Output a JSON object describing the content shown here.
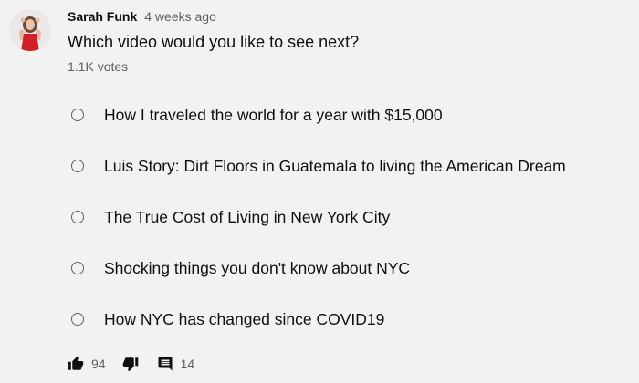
{
  "post": {
    "author": "Sarah Funk",
    "time": "4 weeks ago",
    "question": "Which video would you like to see next?",
    "votes": "1.1K votes",
    "options": [
      {
        "label": "How I traveled the world for a year with $15,000"
      },
      {
        "label": "Luis Story: Dirt Floors in Guatemala to living the American Dream"
      },
      {
        "label": "The True Cost of Living in New York City"
      },
      {
        "label": "Shocking things you don't know about NYC"
      },
      {
        "label": "How NYC has changed since COVID19"
      }
    ]
  },
  "toolbar": {
    "like_count": "94",
    "comment_count": "14",
    "like_icon": "thumbs-up-icon",
    "dislike_icon": "thumbs-down-icon",
    "comment_icon": "comment-icon"
  },
  "colors": {
    "background": "#f2f2f2",
    "text_primary": "#0f0f0f",
    "text_secondary": "#606060",
    "avatar_dress": "#d0202a"
  }
}
